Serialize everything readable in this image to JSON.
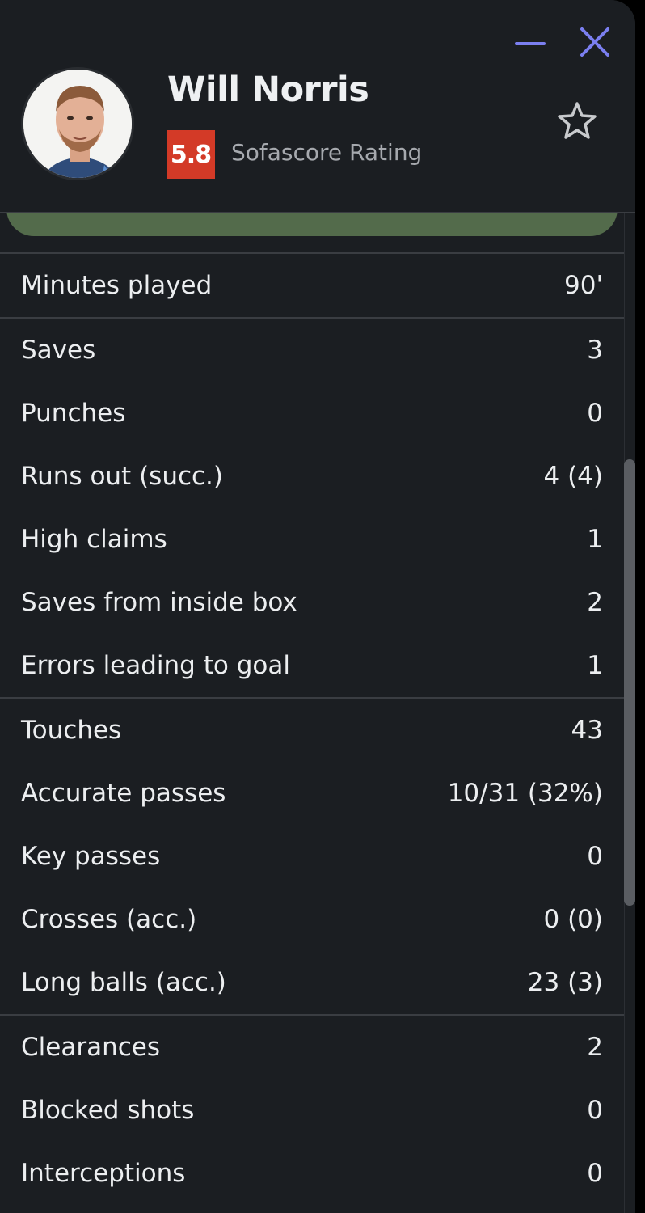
{
  "window": {
    "minimize_icon": "minus-icon",
    "close_icon": "x-icon",
    "accent_color": "#7b7ff0"
  },
  "player": {
    "name": "Will Norris",
    "rating": "5.8",
    "rating_label": "Sofascore Rating",
    "rating_color": "#d33a27",
    "favorite_icon": "star-outline-icon"
  },
  "stats": {
    "general": [
      {
        "label": "Minutes played",
        "value": "90'"
      }
    ],
    "goalkeeping": [
      {
        "label": "Saves",
        "value": "3"
      },
      {
        "label": "Punches",
        "value": "0"
      },
      {
        "label": "Runs out (succ.)",
        "value": "4 (4)"
      },
      {
        "label": "High claims",
        "value": "1"
      },
      {
        "label": "Saves from inside box",
        "value": "2"
      },
      {
        "label": "Errors leading to goal",
        "value": "1"
      }
    ],
    "passing": [
      {
        "label": "Touches",
        "value": "43"
      },
      {
        "label": "Accurate passes",
        "value": "10/31 (32%)"
      },
      {
        "label": "Key passes",
        "value": "0"
      },
      {
        "label": "Crosses (acc.)",
        "value": "0 (0)"
      },
      {
        "label": "Long balls (acc.)",
        "value": "23 (3)"
      }
    ],
    "defending": [
      {
        "label": "Clearances",
        "value": "2"
      },
      {
        "label": "Blocked shots",
        "value": "0"
      },
      {
        "label": "Interceptions",
        "value": "0"
      }
    ]
  }
}
